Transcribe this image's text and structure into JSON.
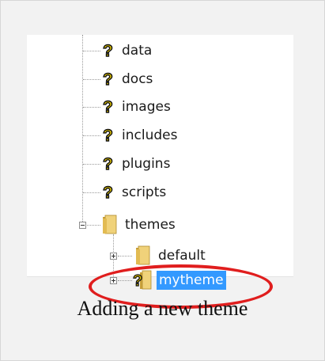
{
  "tree": {
    "items": [
      {
        "label": "data",
        "icon": "unknown-file-icon"
      },
      {
        "label": "docs",
        "icon": "unknown-file-icon"
      },
      {
        "label": "images",
        "icon": "unknown-file-icon"
      },
      {
        "label": "includes",
        "icon": "unknown-file-icon"
      },
      {
        "label": "plugins",
        "icon": "unknown-file-icon"
      },
      {
        "label": "scripts",
        "icon": "unknown-file-icon"
      },
      {
        "label": "themes",
        "icon": "folder-icon",
        "expanded": true,
        "children": [
          {
            "label": "default",
            "icon": "folder-icon",
            "expanded": false
          },
          {
            "label": "mytheme",
            "icon": "unknown-folder-icon",
            "expanded": false,
            "selected": true
          }
        ]
      }
    ]
  },
  "caption": "Adding a new theme",
  "colors": {
    "selection": "#3399ff",
    "highlight_ring": "#e01e1e",
    "folder": "#e8c25a",
    "unknown_mark": "#e6c800"
  }
}
